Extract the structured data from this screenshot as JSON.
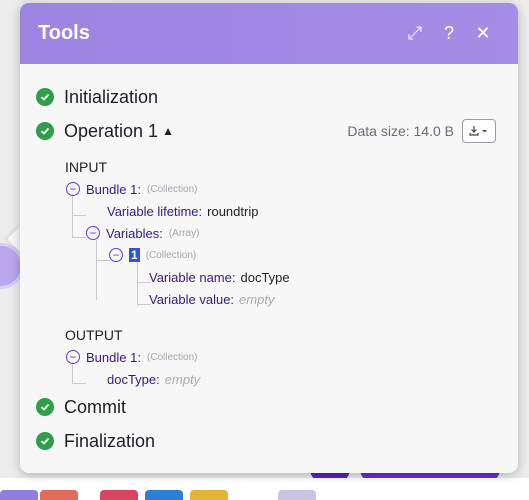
{
  "dialog": {
    "title": "Tools",
    "buttons": {
      "expand": "⤢",
      "help": "?",
      "close": "✕"
    }
  },
  "steps": {
    "initialization": "Initialization",
    "operation": "Operation 1",
    "commit": "Commit",
    "finalization": "Finalization"
  },
  "operation_caret": "▲",
  "data_size": "Data size: 14.0 B",
  "input": {
    "title": "INPUT",
    "bundle_key": "Bundle 1:",
    "bundle_type": "(Collection)",
    "lifetime_key": "Variable lifetime:",
    "lifetime_value": "roundtrip",
    "variables_key": "Variables:",
    "variables_type": "(Array)",
    "item_index": "1",
    "item_type": "(Collection)",
    "name_key": "Variable name:",
    "name_value": "docType",
    "value_key": "Variable value:",
    "value_value": "empty"
  },
  "output": {
    "title": "OUTPUT",
    "bundle_key": "Bundle 1:",
    "bundle_type": "(Collection)",
    "doctype_key": "docType:",
    "doctype_value": "empty"
  },
  "colors": {
    "header": "#9c85e2",
    "check": "#2e9e4a",
    "accent": "#6a3bd0",
    "index_highlight": "#2f55d4"
  }
}
